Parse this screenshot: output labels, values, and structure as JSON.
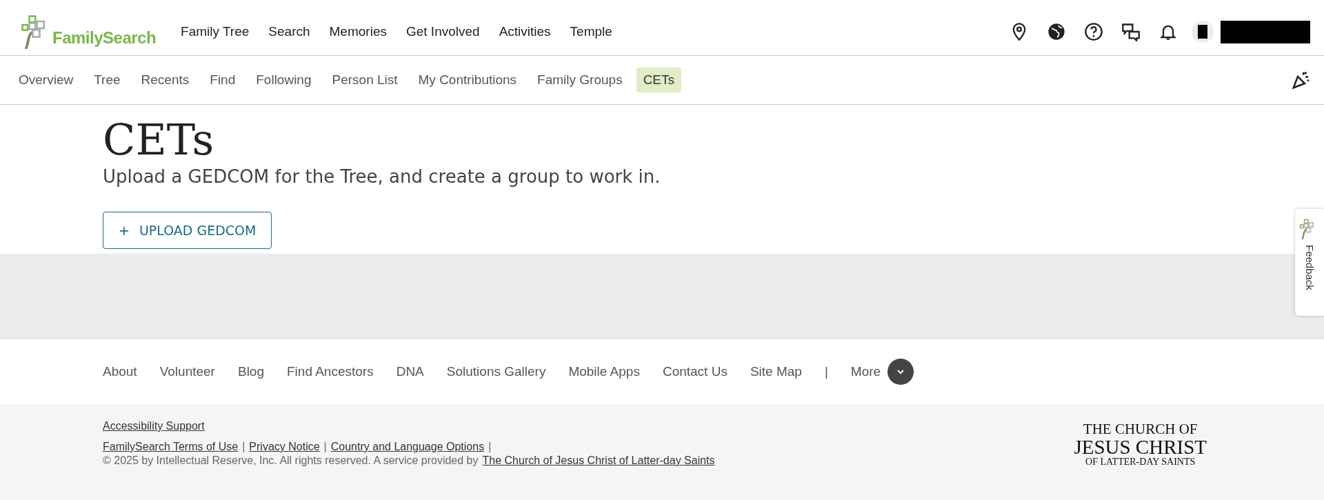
{
  "header": {
    "logo": "FamilySearch",
    "nav": [
      "Family Tree",
      "Search",
      "Memories",
      "Get Involved",
      "Activities",
      "Temple"
    ]
  },
  "subnav": [
    {
      "label": "Overview",
      "selected": false
    },
    {
      "label": "Tree",
      "selected": false
    },
    {
      "label": "Recents",
      "selected": false
    },
    {
      "label": "Find",
      "selected": false
    },
    {
      "label": "Following",
      "selected": false
    },
    {
      "label": "Person List",
      "selected": false
    },
    {
      "label": "My Contributions",
      "selected": false
    },
    {
      "label": "Family Groups",
      "selected": false
    },
    {
      "label": "CETs",
      "selected": true
    }
  ],
  "page": {
    "title": "CETs",
    "subtitle": "Upload a GEDCOM for the Tree, and create a group to work in.",
    "button": {
      "icon": "+",
      "label": "UPLOAD GEDCOM"
    }
  },
  "feedback": "Feedback",
  "footer": {
    "links": [
      "About",
      "Volunteer",
      "Blog",
      "Find Ancestors",
      "DNA",
      "Solutions Gallery",
      "Mobile Apps",
      "Contact Us",
      "Site Map"
    ],
    "separator": "|",
    "more": "More",
    "accessibility": "Accessibility Support",
    "legal_links": [
      "FamilySearch Terms of Use",
      "Privacy Notice",
      "Country and Language Options"
    ],
    "legal_separator": "|",
    "copyright": "© 2025 by Intellectual Reserve, Inc. All rights reserved. A service provided by",
    "church_link": "The Church of Jesus Christ of Latter-day Saints",
    "church_logo": [
      "THE CHURCH OF",
      "JESUS CHRIST",
      "OF LATTER-DAY SAINTS"
    ]
  }
}
